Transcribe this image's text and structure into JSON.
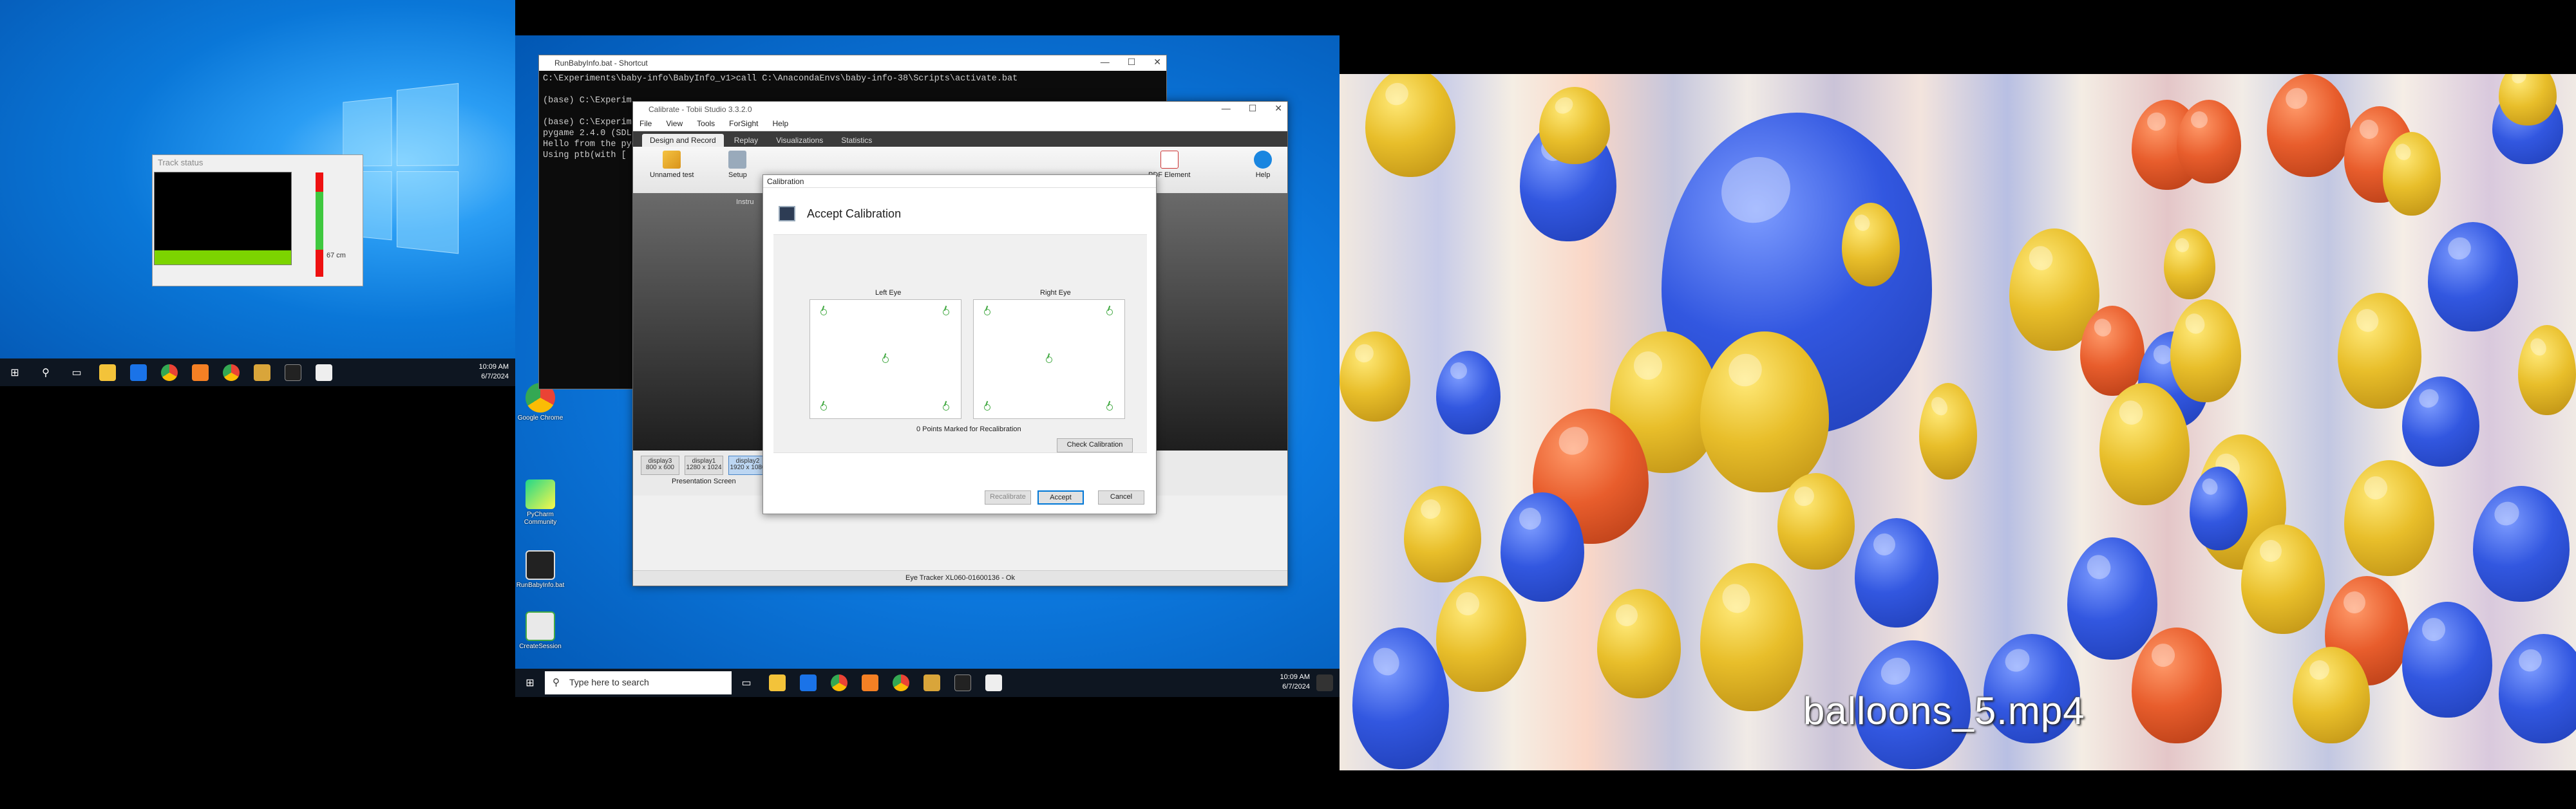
{
  "left_screen": {
    "track_status_title": "Track status",
    "distance": "67 cm",
    "clock_time": "10:09 AM",
    "clock_date": "6/7/2024"
  },
  "middle_screen": {
    "cmd": {
      "title": "RunBabyInfo.bat - Shortcut",
      "lines": [
        "C:\\Experiments\\baby-info\\BabyInfo_v1>call C:\\AnacondaEnvs\\baby-info-38\\Scripts\\activate.bat",
        "",
        "(base) C:\\Experim",
        "",
        "(base) C:\\Experim",
        "pygame 2.4.0 (SDL",
        "Hello from the pyg",
        "Using ptb(with [ 'P"
      ]
    },
    "tobii": {
      "title": "Calibrate - Tobii Studio 3.3.2.0",
      "menu": [
        "File",
        "View",
        "Tools",
        "ForSight",
        "Help"
      ],
      "tabs": [
        "Design and Record",
        "Replay",
        "Visualizations",
        "Statistics"
      ],
      "ribbon": {
        "unnamed_test": "Unnamed test",
        "setup": "Setup",
        "instruction": "Instru",
        "pdf_element": "PDF Element",
        "help": "Help"
      },
      "displays": [
        {
          "label": "display3",
          "sub": "800 x 600"
        },
        {
          "label": "display1",
          "sub": "1280 x 1024"
        },
        {
          "label": "display2",
          "sub": "1920 x 1080"
        }
      ],
      "presentation_screen": "Presentation Screen",
      "status": "Eye Tracker XL060-01600136 - Ok"
    },
    "calibration": {
      "window_title": "Calibration",
      "heading": "Accept Calibration",
      "left_eye": "Left Eye",
      "right_eye": "Right Eye",
      "points_marked": "0 Points Marked for Recalibration",
      "check_button": "Check Calibration",
      "recalibrate_button": "Recalibrate",
      "accept_button": "Accept",
      "cancel_button": "Cancel"
    },
    "taskbar": {
      "search_placeholder": "Type here to search",
      "clock_time": "10:09 AM",
      "clock_date": "6/7/2024"
    },
    "desktop_icons": [
      "Google Chrome",
      "PyCharm Community",
      "Chrome",
      "RunBabyInfo.bat",
      "CreateSession"
    ]
  },
  "right_screen": {
    "video_label": "balloons_5.mp4"
  },
  "colors": {
    "win_blue": "#0a77d8",
    "accent": "#0078d7",
    "gaze_green": "#44aa44"
  }
}
